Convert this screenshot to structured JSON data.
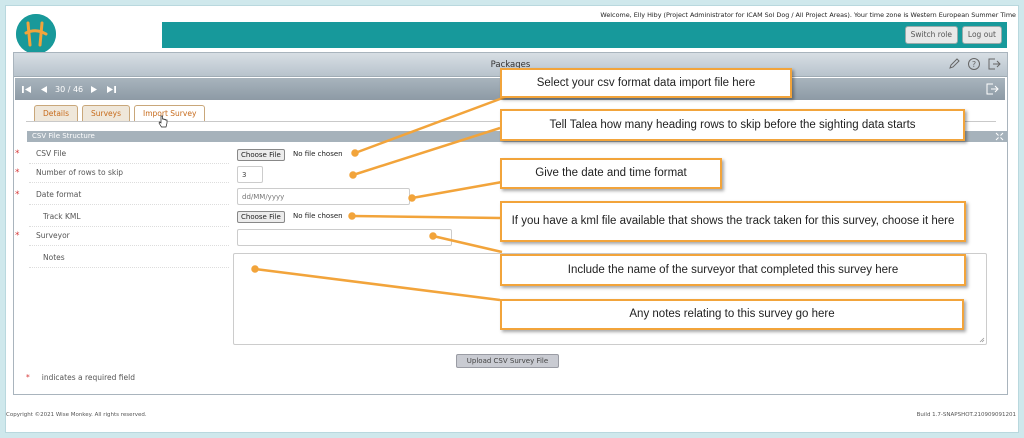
{
  "header": {
    "welcome_text": "Welcome, Elly Hiby (Project Administrator for ICAM Sol Dog / All Project Areas). Your time zone is Western European Summer Time",
    "switch_role_label": "Switch role",
    "logout_label": "Log out",
    "logo_icon": "talea-logo-icon"
  },
  "panel": {
    "title": "Packages",
    "nav": {
      "counter": "30 / 46"
    },
    "tabs": [
      {
        "label": "Details",
        "active": false
      },
      {
        "label": "Surveys",
        "active": false
      },
      {
        "label": "Import Survey",
        "active": true
      }
    ],
    "section_title": "CSV File Structure"
  },
  "form": {
    "csv_file_label": "CSV File",
    "choose_file_label": "Choose File",
    "no_file_text": "No file chosen",
    "rows_to_skip_label": "Number of rows to skip",
    "rows_to_skip_value": "3",
    "date_format_label": "Date format",
    "date_format_placeholder": "dd/MM/yyyy",
    "track_kml_label": "Track KML",
    "kml_choose_file_label": "Choose File",
    "kml_no_file_text": "No file chosen",
    "surveyor_label": "Surveyor",
    "notes_label": "Notes",
    "upload_button_label": "Upload CSV Survey File",
    "required_star": "*",
    "required_note": "indicates a required field"
  },
  "callouts": {
    "csv_file": "Select your csv format data import file here",
    "rows_skip": "Tell Talea how many heading rows to skip before the sighting data starts",
    "date_format": "Give the date and time format",
    "kml": "If you have a kml file available that shows the track taken for this survey, choose it here",
    "surveyor": "Include the name of the surveyor that completed this survey here",
    "notes": "Any notes relating to this survey go here"
  },
  "footer": {
    "copyright": "Copyright ©2021 Wise Monkey. All rights reserved.",
    "build": "Build 1.7-SNAPSHOT.210909091201"
  },
  "colors": {
    "teal": "#17999b",
    "callout_border": "#f2a43b",
    "required": "#d63a3a"
  }
}
